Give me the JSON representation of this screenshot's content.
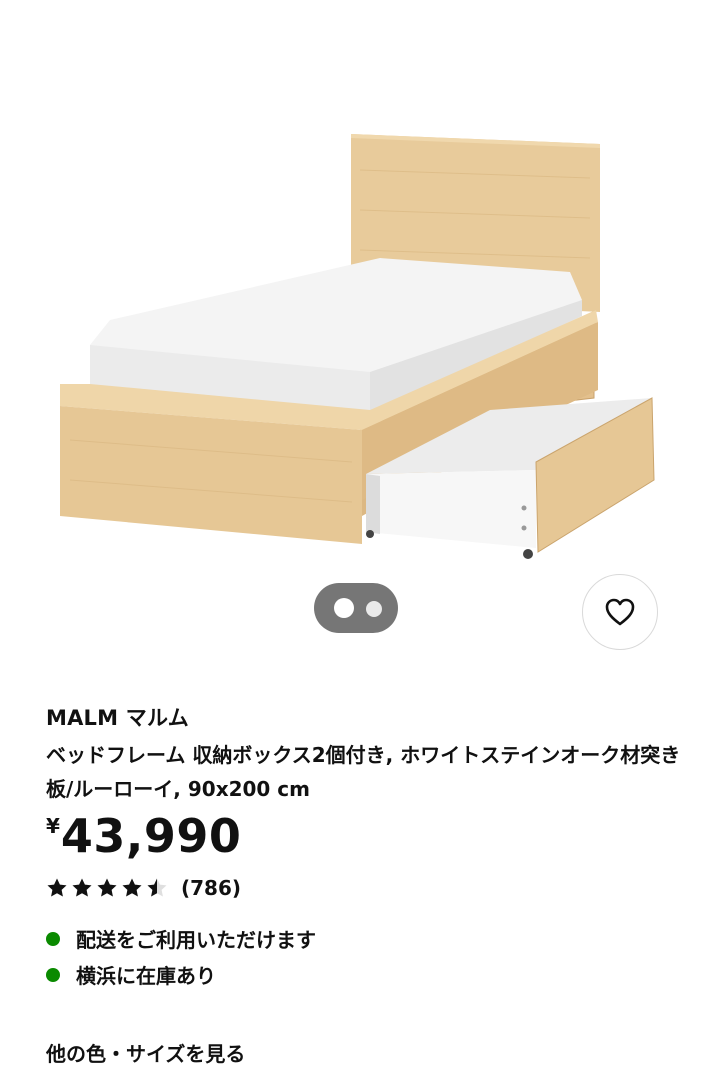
{
  "product": {
    "name": "MALM マルム",
    "description": "ベッドフレーム 収納ボックス2個付き, ホワイトステインオーク材突き板/ルーローイ, 90x200 cm",
    "currency": "¥",
    "price": "43,990",
    "rating": 4.5,
    "rating_max": 5,
    "review_count": "(786)"
  },
  "availability": {
    "delivery_label": "配送をご利用いただけます",
    "stock_label": "横浜に在庫あり",
    "status_color": "#0a8a00"
  },
  "links": {
    "more_colors_sizes": "他の色・サイズを見る"
  },
  "gallery": {
    "image_count": 2,
    "active_index": 0
  },
  "icons": {
    "favorite": "heart-icon",
    "star": "star-icon"
  },
  "colors": {
    "wood": "#e6c795",
    "indicator_bg": "#767676",
    "text": "#111111"
  }
}
